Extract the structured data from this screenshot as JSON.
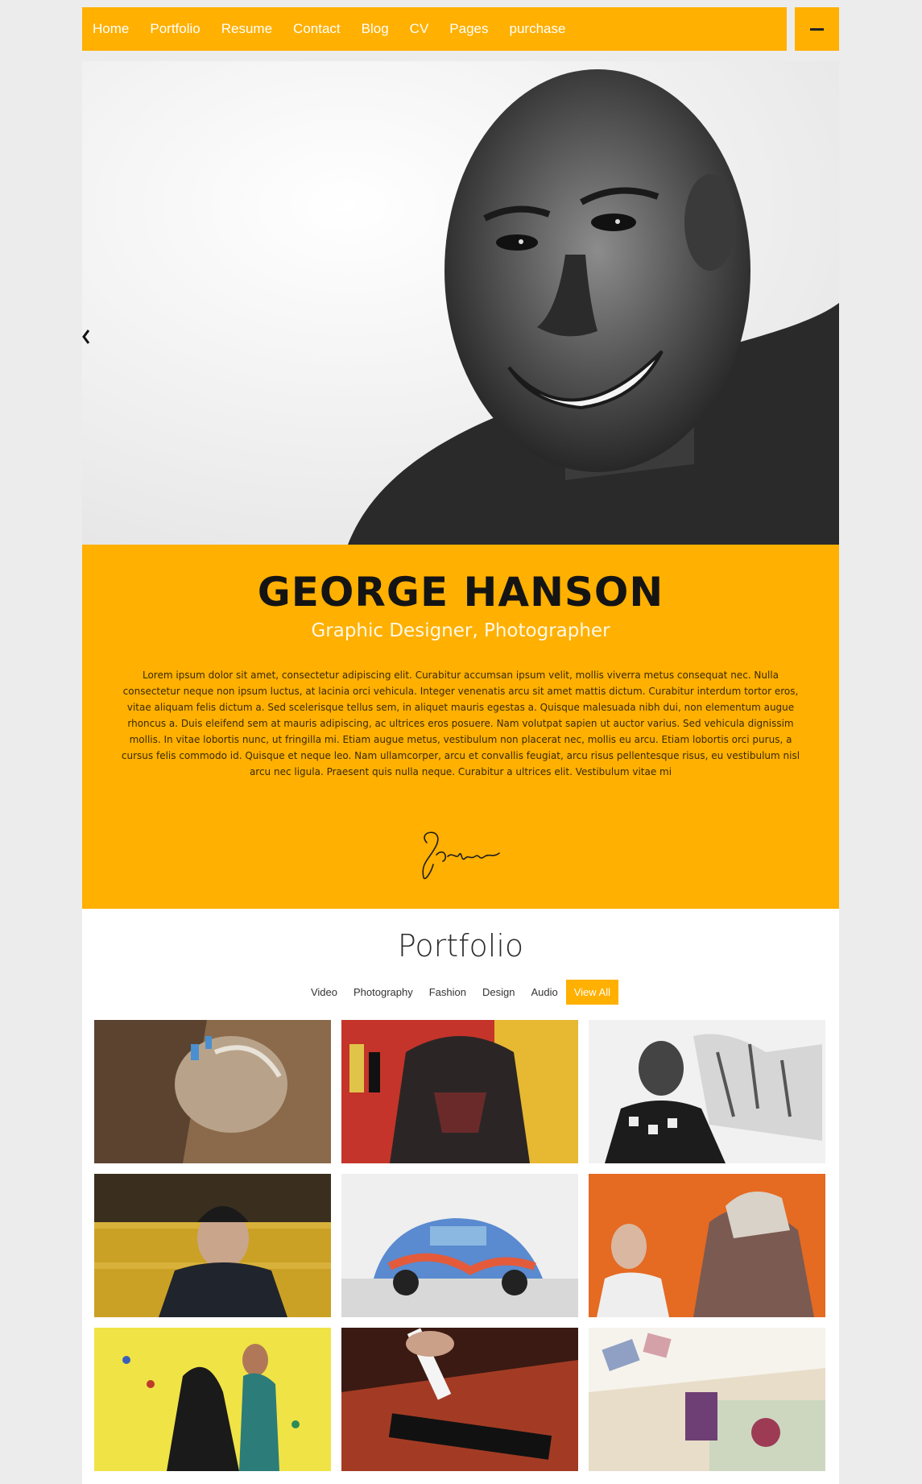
{
  "nav": {
    "items": [
      "Home",
      "Portfolio",
      "Resume",
      "Contact",
      "Blog",
      "CV",
      "Pages",
      "purchase"
    ],
    "menu_icon": "hamburger-minus-icon"
  },
  "hero": {
    "prev_icon": "chevron-left-icon"
  },
  "profile": {
    "name": "GEORGE HANSON",
    "role": "Graphic Designer, Photographer",
    "bio": "Lorem ipsum dolor sit amet, consectetur adipiscing elit. Curabitur accumsan ipsum velit, mollis viverra metus consequat nec. Nulla consectetur neque non ipsum luctus, at lacinia orci vehicula. Integer venenatis arcu sit amet mattis dictum. Curabitur interdum tortor eros, vitae aliquam felis dictum a. Sed scelerisque tellus sem, in aliquet mauris egestas a. Quisque malesuada nibh dui, non elementum augue rhoncus a. Duis eleifend sem at mauris adipiscing, ac ultrices eros posuere. Nam volutpat sapien ut auctor varius. Sed vehicula dignissim mollis. In vitae lobortis nunc, ut fringilla mi. Etiam augue metus, vestibulum non placerat nec, mollis eu arcu. Etiam lobortis orci purus, a cursus felis commodo id. Quisque et neque leo. Nam ullamcorper, arcu et convallis feugiat, arcu risus pellentesque risus, eu vestibulum nisl arcu nec ligula. Praesent quis nulla neque. Curabitur a ultrices elit. Vestibulum vitae mi",
    "signature": "Signature"
  },
  "portfolio": {
    "title": "Portfolio",
    "filters": [
      "Video",
      "Photography",
      "Fashion",
      "Design",
      "Audio",
      "View All"
    ],
    "active_filter": "View All"
  },
  "colors": {
    "accent": "#ffb000",
    "background": "#ececec"
  }
}
